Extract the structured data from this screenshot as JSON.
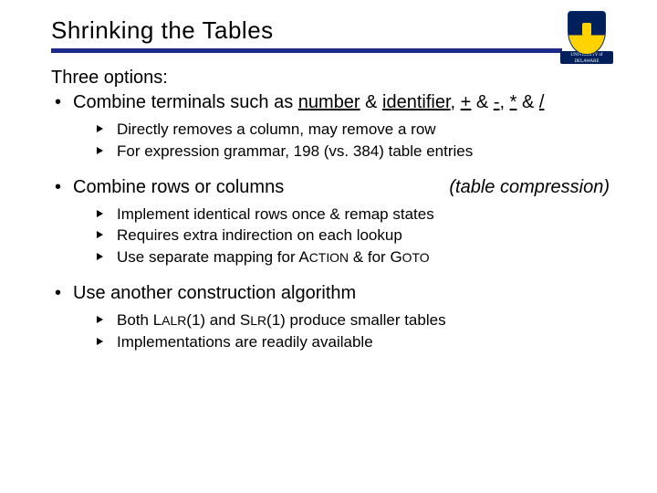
{
  "logo": {
    "name": "University of Delaware",
    "banner_line1": "UNIVERSITY of",
    "banner_line2": "DELAWARE"
  },
  "title": "Shrinking the Tables",
  "intro": "Three options:",
  "bullets": [
    {
      "text_pre": "Combine terminals such as ",
      "u1": "number",
      "amp1": " & ",
      "u2": "identifier",
      "sep1": ", ",
      "u3": "+",
      "amp2": " & ",
      "u4": "-",
      "sep2": ", ",
      "u5": "*",
      "amp3": " & ",
      "u6": "/",
      "aside": "",
      "subs": [
        "Directly removes a column, may remove a row",
        "For expression grammar, 198 (vs. 384) table entries"
      ]
    },
    {
      "text": "Combine rows or columns",
      "aside": "(table compression)",
      "subs": [
        "Implement identical rows once & remap states",
        "Requires extra indirection on each lookup",
        "Use separate mapping for ACTION & for GOTO"
      ]
    },
    {
      "text": "Use another construction algorithm",
      "aside": "",
      "subs": [
        "Both LALR(1) and SLR(1) produce smaller tables",
        "Implementations are readily available"
      ]
    }
  ]
}
